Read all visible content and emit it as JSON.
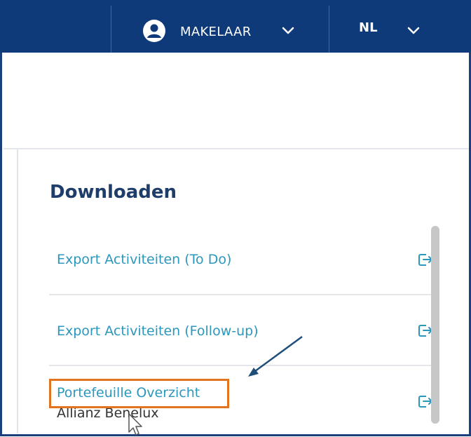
{
  "header": {
    "role_label": "MAKELAAR",
    "language": "NL",
    "user_icon": "user-circle-icon",
    "chevron_icon": "chevron-down-icon"
  },
  "section": {
    "title": "Downloaden",
    "items": [
      {
        "label": "Export Activiteiten (To Do)",
        "subtitle": "",
        "icon": "export-icon"
      },
      {
        "label": "Export Activiteiten (Follow-up)",
        "subtitle": "",
        "icon": "export-icon"
      },
      {
        "label": "Portefeuille Overzicht",
        "subtitle": "Allianz Benelux",
        "icon": "export-icon"
      }
    ]
  },
  "annotation": {
    "highlight_color": "#e2731f",
    "arrow_color": "#1e4e79",
    "cursor_icon": "mouse-pointer-icon"
  },
  "colors": {
    "topbar": "#0e3a7a",
    "link": "#2b97bd",
    "title": "#1f3d6b"
  }
}
